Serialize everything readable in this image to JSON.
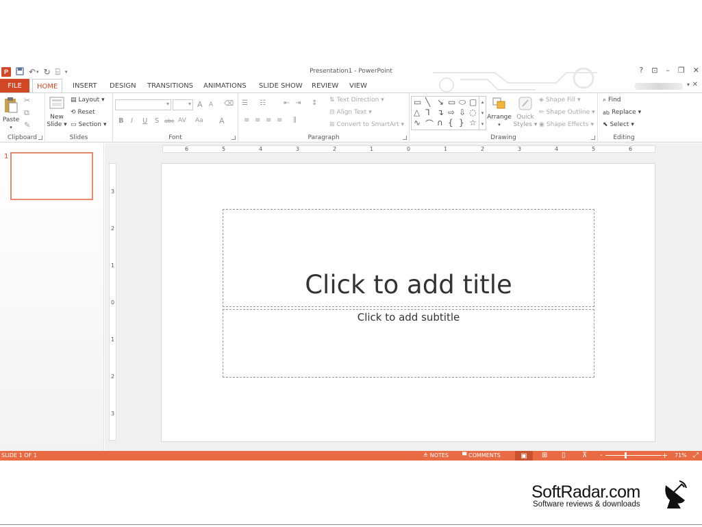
{
  "window": {
    "title": "Presentation1 - PowerPoint",
    "help": "?",
    "app_badge": "P"
  },
  "tabs": [
    "FILE",
    "HOME",
    "INSERT",
    "DESIGN",
    "TRANSITIONS",
    "ANIMATIONS",
    "SLIDE SHOW",
    "REVIEW",
    "VIEW"
  ],
  "active_tab": "HOME",
  "ribbon": {
    "clipboard": {
      "label": "Clipboard",
      "paste": "Paste"
    },
    "slides": {
      "label": "Slides",
      "new_slide_1": "New",
      "new_slide_2": "Slide",
      "layout": "Layout",
      "reset": "Reset",
      "section": "Section"
    },
    "font": {
      "label": "Font",
      "bold": "B",
      "italic": "I",
      "underline": "U",
      "shadow": "S",
      "strike": "abc",
      "spacing": "AV",
      "case": "Aa",
      "color": "A",
      "grow": "A",
      "shrink": "A"
    },
    "paragraph": {
      "label": "Paragraph",
      "text_direction": "Text Direction",
      "align_text": "Align Text",
      "convert_smartart": "Convert to SmartArt"
    },
    "drawing": {
      "label": "Drawing",
      "arrange": "Arrange",
      "quick_styles_1": "Quick",
      "quick_styles_2": "Styles",
      "shape_fill": "Shape Fill",
      "shape_outline": "Shape Outline",
      "shape_effects": "Shape Effects"
    },
    "editing": {
      "label": "Editing",
      "find": "Find",
      "replace": "Replace",
      "select": "Select"
    }
  },
  "thumbnails": [
    {
      "number": "1"
    }
  ],
  "ruler": {
    "horizontal": [
      "6",
      "5",
      "4",
      "3",
      "2",
      "1",
      "0",
      "1",
      "2",
      "3",
      "4",
      "5",
      "6"
    ],
    "vertical": [
      "3",
      "2",
      "1",
      "0",
      "1",
      "2",
      "3"
    ]
  },
  "slide": {
    "title_placeholder": "Click to add title",
    "subtitle_placeholder": "Click to add subtitle"
  },
  "status": {
    "slide_info": "SLIDE 1 OF 1",
    "notes": "NOTES",
    "comments": "COMMENTS",
    "zoom": "71%",
    "zoom_minus": "-",
    "zoom_plus": "+"
  },
  "watermark": {
    "title": "SoftRadar.com",
    "subtitle": "Software reviews & downloads"
  },
  "colors": {
    "accent": "#d24726",
    "status_bar": "#e86b44"
  }
}
